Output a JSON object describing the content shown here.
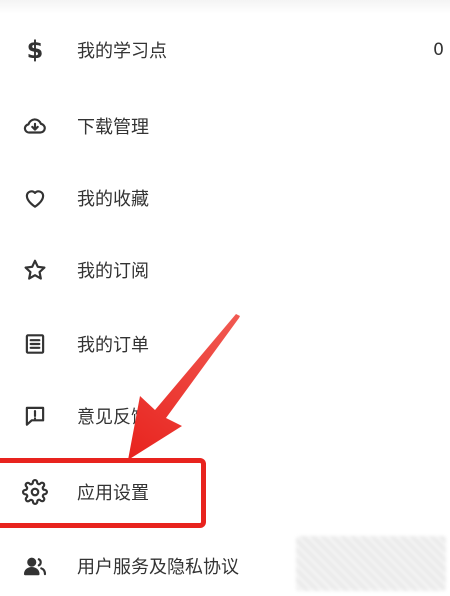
{
  "menu": {
    "items": [
      {
        "label": "我的学习点",
        "icon": "dollar-icon",
        "value": "0"
      },
      {
        "label": "下载管理",
        "icon": "cloud-download-icon"
      },
      {
        "label": "我的收藏",
        "icon": "heart-icon"
      },
      {
        "label": "我的订阅",
        "icon": "star-icon"
      },
      {
        "label": "我的订单",
        "icon": "document-list-icon"
      },
      {
        "label": "意见反馈",
        "icon": "feedback-icon"
      },
      {
        "label": "应用设置",
        "icon": "gear-icon"
      },
      {
        "label": "用户服务及隐私协议",
        "icon": "users-icon"
      }
    ]
  },
  "annotation": {
    "highlight_color": "#e8231e",
    "highlighted_item": "应用设置"
  },
  "colors": {
    "text": "#333333",
    "background": "#ffffff"
  }
}
